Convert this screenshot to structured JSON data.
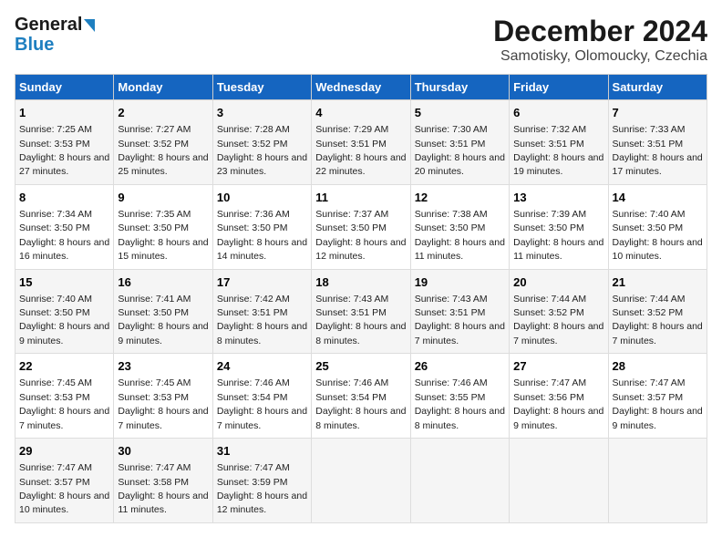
{
  "logo": {
    "line1": "General",
    "line2": "Blue"
  },
  "title": "December 2024",
  "subtitle": "Samotisky, Olomoucky, Czechia",
  "weekdays": [
    "Sunday",
    "Monday",
    "Tuesday",
    "Wednesday",
    "Thursday",
    "Friday",
    "Saturday"
  ],
  "weeks": [
    [
      {
        "day": "1",
        "sunrise": "7:25 AM",
        "sunset": "3:53 PM",
        "daylight": "8 hours and 27 minutes."
      },
      {
        "day": "2",
        "sunrise": "7:27 AM",
        "sunset": "3:52 PM",
        "daylight": "8 hours and 25 minutes."
      },
      {
        "day": "3",
        "sunrise": "7:28 AM",
        "sunset": "3:52 PM",
        "daylight": "8 hours and 23 minutes."
      },
      {
        "day": "4",
        "sunrise": "7:29 AM",
        "sunset": "3:51 PM",
        "daylight": "8 hours and 22 minutes."
      },
      {
        "day": "5",
        "sunrise": "7:30 AM",
        "sunset": "3:51 PM",
        "daylight": "8 hours and 20 minutes."
      },
      {
        "day": "6",
        "sunrise": "7:32 AM",
        "sunset": "3:51 PM",
        "daylight": "8 hours and 19 minutes."
      },
      {
        "day": "7",
        "sunrise": "7:33 AM",
        "sunset": "3:51 PM",
        "daylight": "8 hours and 17 minutes."
      }
    ],
    [
      {
        "day": "8",
        "sunrise": "7:34 AM",
        "sunset": "3:50 PM",
        "daylight": "8 hours and 16 minutes."
      },
      {
        "day": "9",
        "sunrise": "7:35 AM",
        "sunset": "3:50 PM",
        "daylight": "8 hours and 15 minutes."
      },
      {
        "day": "10",
        "sunrise": "7:36 AM",
        "sunset": "3:50 PM",
        "daylight": "8 hours and 14 minutes."
      },
      {
        "day": "11",
        "sunrise": "7:37 AM",
        "sunset": "3:50 PM",
        "daylight": "8 hours and 12 minutes."
      },
      {
        "day": "12",
        "sunrise": "7:38 AM",
        "sunset": "3:50 PM",
        "daylight": "8 hours and 11 minutes."
      },
      {
        "day": "13",
        "sunrise": "7:39 AM",
        "sunset": "3:50 PM",
        "daylight": "8 hours and 11 minutes."
      },
      {
        "day": "14",
        "sunrise": "7:40 AM",
        "sunset": "3:50 PM",
        "daylight": "8 hours and 10 minutes."
      }
    ],
    [
      {
        "day": "15",
        "sunrise": "7:40 AM",
        "sunset": "3:50 PM",
        "daylight": "8 hours and 9 minutes."
      },
      {
        "day": "16",
        "sunrise": "7:41 AM",
        "sunset": "3:50 PM",
        "daylight": "8 hours and 9 minutes."
      },
      {
        "day": "17",
        "sunrise": "7:42 AM",
        "sunset": "3:51 PM",
        "daylight": "8 hours and 8 minutes."
      },
      {
        "day": "18",
        "sunrise": "7:43 AM",
        "sunset": "3:51 PM",
        "daylight": "8 hours and 8 minutes."
      },
      {
        "day": "19",
        "sunrise": "7:43 AM",
        "sunset": "3:51 PM",
        "daylight": "8 hours and 7 minutes."
      },
      {
        "day": "20",
        "sunrise": "7:44 AM",
        "sunset": "3:52 PM",
        "daylight": "8 hours and 7 minutes."
      },
      {
        "day": "21",
        "sunrise": "7:44 AM",
        "sunset": "3:52 PM",
        "daylight": "8 hours and 7 minutes."
      }
    ],
    [
      {
        "day": "22",
        "sunrise": "7:45 AM",
        "sunset": "3:53 PM",
        "daylight": "8 hours and 7 minutes."
      },
      {
        "day": "23",
        "sunrise": "7:45 AM",
        "sunset": "3:53 PM",
        "daylight": "8 hours and 7 minutes."
      },
      {
        "day": "24",
        "sunrise": "7:46 AM",
        "sunset": "3:54 PM",
        "daylight": "8 hours and 7 minutes."
      },
      {
        "day": "25",
        "sunrise": "7:46 AM",
        "sunset": "3:54 PM",
        "daylight": "8 hours and 8 minutes."
      },
      {
        "day": "26",
        "sunrise": "7:46 AM",
        "sunset": "3:55 PM",
        "daylight": "8 hours and 8 minutes."
      },
      {
        "day": "27",
        "sunrise": "7:47 AM",
        "sunset": "3:56 PM",
        "daylight": "8 hours and 9 minutes."
      },
      {
        "day": "28",
        "sunrise": "7:47 AM",
        "sunset": "3:57 PM",
        "daylight": "8 hours and 9 minutes."
      }
    ],
    [
      {
        "day": "29",
        "sunrise": "7:47 AM",
        "sunset": "3:57 PM",
        "daylight": "8 hours and 10 minutes."
      },
      {
        "day": "30",
        "sunrise": "7:47 AM",
        "sunset": "3:58 PM",
        "daylight": "8 hours and 11 minutes."
      },
      {
        "day": "31",
        "sunrise": "7:47 AM",
        "sunset": "3:59 PM",
        "daylight": "8 hours and 12 minutes."
      },
      null,
      null,
      null,
      null
    ]
  ]
}
